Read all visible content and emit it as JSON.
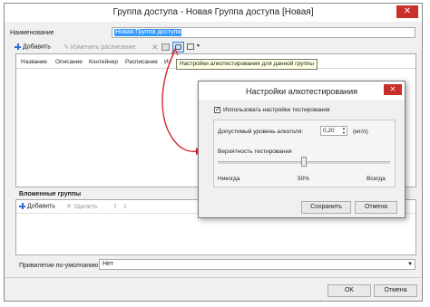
{
  "window": {
    "title": "Группа доступа - Новая Группа доступа [Новая]",
    "close_glyph": "✕"
  },
  "name_field": {
    "label": "Наименование",
    "value": "Новая Группа доступа"
  },
  "toolbar": {
    "add_label": "Добавить",
    "edit_schedule_label": "Изменить расписание"
  },
  "tooltip": "Настройки алкотестирования для данной группы",
  "schedule_table": {
    "columns": [
      "Название",
      "Описание",
      "Контейнер",
      "Расписание",
      "Из"
    ]
  },
  "nested_groups": {
    "heading": "Вложенные группы",
    "add_label": "Добавить",
    "delete_label": "Удалить"
  },
  "privileges": {
    "label": "Привилегии по-умолчанию",
    "value": "Нет"
  },
  "footer": {
    "ok_label": "OK",
    "cancel_label": "Отмена"
  },
  "dialog": {
    "title": "Настройки алкотестирования",
    "close_glyph": "✕",
    "use_testing_label": "Использовать настройки тестирования",
    "use_testing_checked": true,
    "alcohol_level_label": "Допустимый уровень алкоголя:",
    "alcohol_level_value": "0,20",
    "alcohol_unit": "(мг/л)",
    "probability_label": "Вероятность тестирования",
    "slider_min_label": "Никогда",
    "slider_mid_label": "50%",
    "slider_max_label": "Всегда",
    "slider_value_percent": 50,
    "save_label": "Сохранить",
    "cancel_label": "Отмена"
  },
  "colors": {
    "accent": "#3399ff",
    "close": "#c9302c",
    "arrow": "#d9262c"
  }
}
